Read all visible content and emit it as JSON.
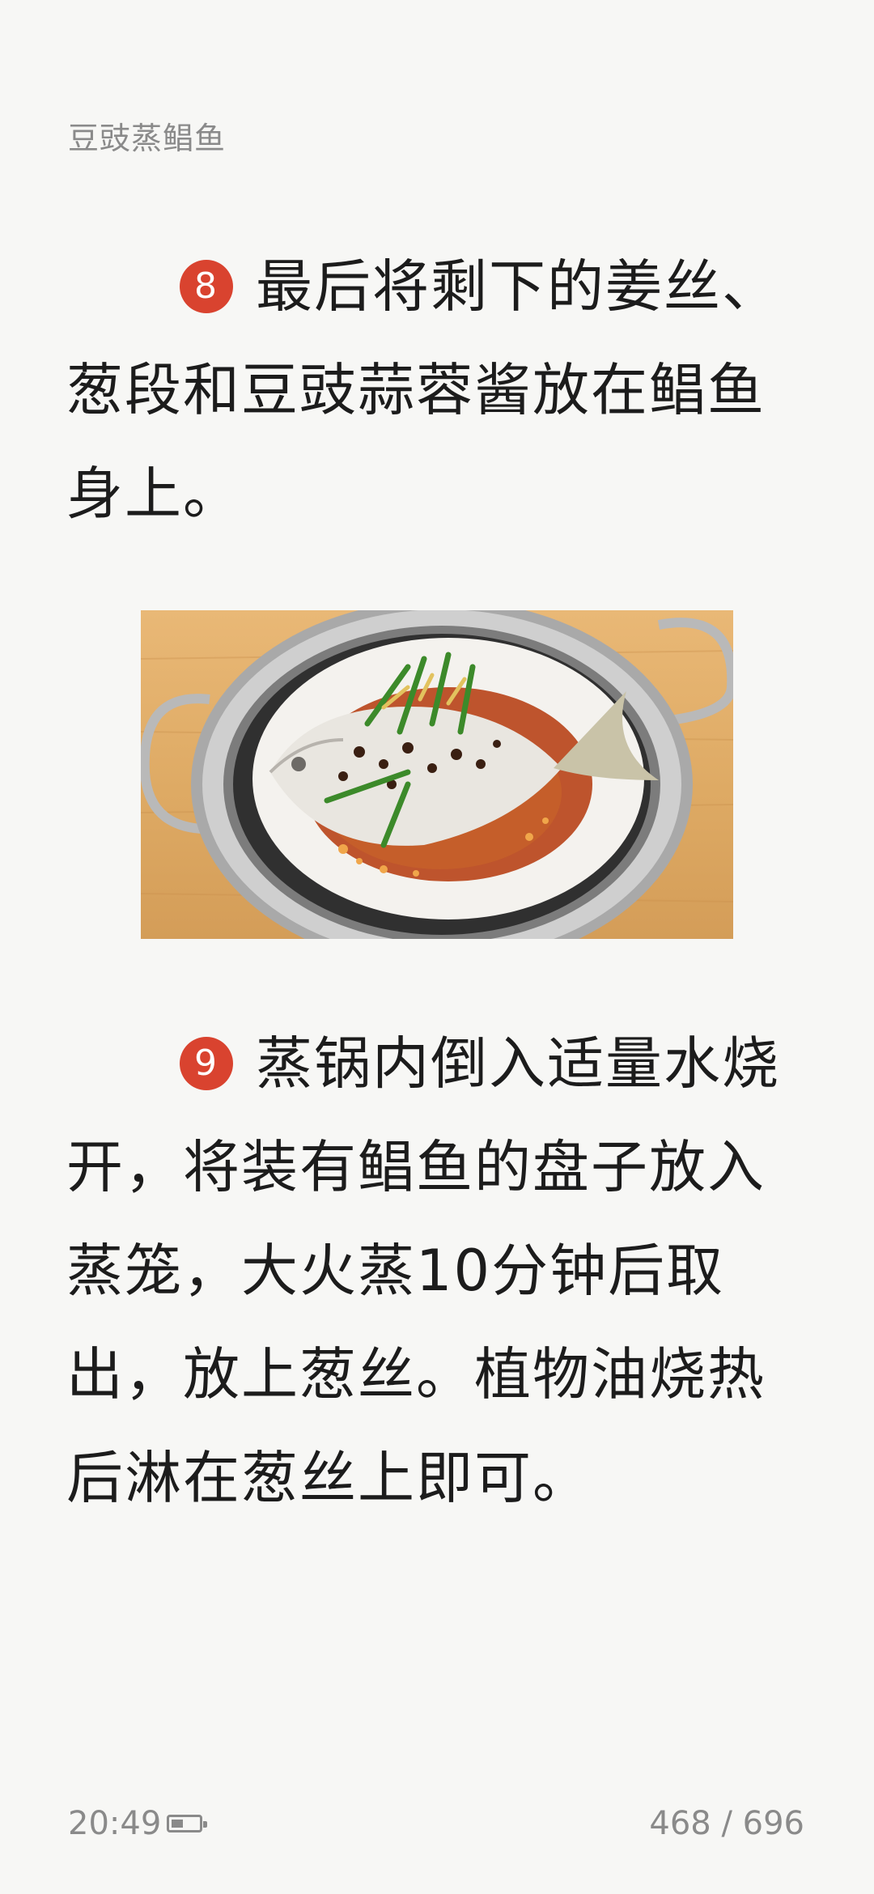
{
  "header": {
    "title": "豆豉蒸鲳鱼"
  },
  "steps": [
    {
      "number": "8",
      "text": "最后将剩下的姜丝、葱段和豆豉蒜蓉酱放在鲳鱼身上。"
    },
    {
      "number": "9",
      "text": "蒸锅内倒入适量水烧开，将装有鲳鱼的盘子放入蒸笼，大火蒸10分钟后取出，放上葱丝。植物油烧热后淋在葱丝上即可。"
    }
  ],
  "footer": {
    "time": "20:49",
    "page": "468 / 696"
  },
  "colors": {
    "badge": "#d9432f",
    "background": "#f7f7f5",
    "meta_text": "#8a8a8a"
  }
}
